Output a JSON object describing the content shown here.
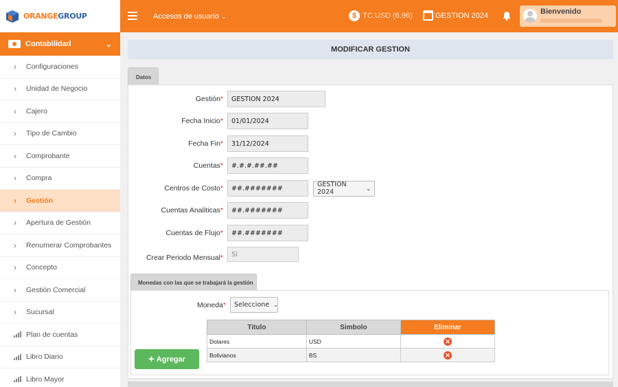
{
  "brand": {
    "orange": "ORANGE",
    "group": "GROUP"
  },
  "topbar": {
    "access_menu": "Accesos de usuario",
    "exchange_rate": "TC.USD (6.96)",
    "current_gestion": "GESTION 2024",
    "welcome": "Bienvenido"
  },
  "sidebar": {
    "section": "Contabilidad",
    "items": [
      {
        "label": "Configuraciones"
      },
      {
        "label": "Unidad de Negocio"
      },
      {
        "label": "Cajero"
      },
      {
        "label": "Tipo de Cambio"
      },
      {
        "label": "Comprobante"
      },
      {
        "label": "Compra"
      },
      {
        "label": "Gestión"
      },
      {
        "label": "Apertura de Gestión"
      },
      {
        "label": "Renumerar Comprobantes"
      },
      {
        "label": "Concepto"
      },
      {
        "label": "Gestión Comercial"
      },
      {
        "label": "Sucursal"
      },
      {
        "label": "Plan de cuentas"
      },
      {
        "label": "Libro Diario"
      },
      {
        "label": "Libro Mayor"
      }
    ]
  },
  "page": {
    "title": "MODIFICAR GESTION",
    "tab": "Datos",
    "form": {
      "gestion_label": "Gestión",
      "gestion_value": "GESTION 2024",
      "fecha_inicio_label": "Fecha Inicio",
      "fecha_inicio_value": "01/01/2024",
      "fecha_fin_label": "Fecha Fin",
      "fecha_fin_value": "31/12/2024",
      "cuentas_label": "Cuentas",
      "cuentas_value": "#.#.#.##.##",
      "centros_label": "Centros de Costo",
      "centros_value": "##.#######",
      "centros_select": "GESTION 2024",
      "analiticas_label": "Cuentas Analiticas",
      "analiticas_value": "##.#######",
      "flujo_label": "Cuentas de Flujo",
      "flujo_value": "##.#######",
      "periodo_label": "Crear Periodo Mensual",
      "periodo_value": "Si"
    },
    "monedas": {
      "tab": "Monedas con las que se trabajará la gestión",
      "moneda_label": "Moneda",
      "moneda_select": "Seleccione",
      "columns": [
        "Titulo",
        "Simbolo",
        "Eliminar"
      ],
      "rows": [
        {
          "titulo": "Dolares",
          "simbolo": "USD"
        },
        {
          "titulo": "Bolivianos",
          "simbolo": "BS"
        }
      ],
      "add_label": "Agregar"
    }
  },
  "colors": {
    "accent": "#f57c1f",
    "success": "#5cb85c",
    "danger": "#e8542e",
    "title_bar": "#dfe5ef"
  }
}
